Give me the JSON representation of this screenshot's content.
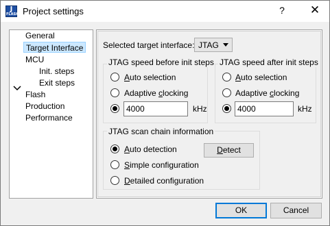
{
  "window": {
    "title": "Project settings",
    "icon": {
      "name": "jlink-app-icon",
      "glyph": "J",
      "sub_text": "FLASH"
    },
    "help_glyph": "?",
    "close_glyph": "✕"
  },
  "tree": {
    "items": [
      {
        "label": "General"
      },
      {
        "label": "Target Interface",
        "selected": true
      },
      {
        "label": "MCU",
        "expanded": true
      },
      {
        "label": "Init. steps"
      },
      {
        "label": "Exit steps"
      },
      {
        "label": "Flash"
      },
      {
        "label": "Production"
      },
      {
        "label": "Performance"
      }
    ]
  },
  "panel": {
    "target_interface_label": "Selected target interface:",
    "target_interface_value": "JTAG",
    "speed_before": {
      "title": "JTAG speed before init steps",
      "auto_pre": "",
      "auto_acc": "A",
      "auto_post": "uto selection",
      "adaptive_pre": "Adaptive ",
      "adaptive_acc": "c",
      "adaptive_post": "locking",
      "speed_value": "4000",
      "unit": "kHz",
      "selected": "custom"
    },
    "speed_after": {
      "title": "JTAG speed after init steps",
      "auto_pre": "",
      "auto_acc": "A",
      "auto_post": "uto selection",
      "adaptive_pre": "Adaptive ",
      "adaptive_acc": "c",
      "adaptive_post": "locking",
      "speed_value": "4000",
      "unit": "kHz",
      "selected": "custom"
    },
    "scan_chain": {
      "title": "JTAG scan chain information",
      "auto_pre": "",
      "auto_acc": "A",
      "auto_post": "uto detection",
      "simple_pre": "",
      "simple_acc": "S",
      "simple_post": "imple configuration",
      "detailed_pre": "",
      "detailed_acc": "D",
      "detailed_post": "etailed configuration",
      "detect_pre": "",
      "detect_acc": "D",
      "detect_post": "etect",
      "selected": "auto"
    }
  },
  "buttons": {
    "ok": "OK",
    "cancel": "Cancel"
  }
}
